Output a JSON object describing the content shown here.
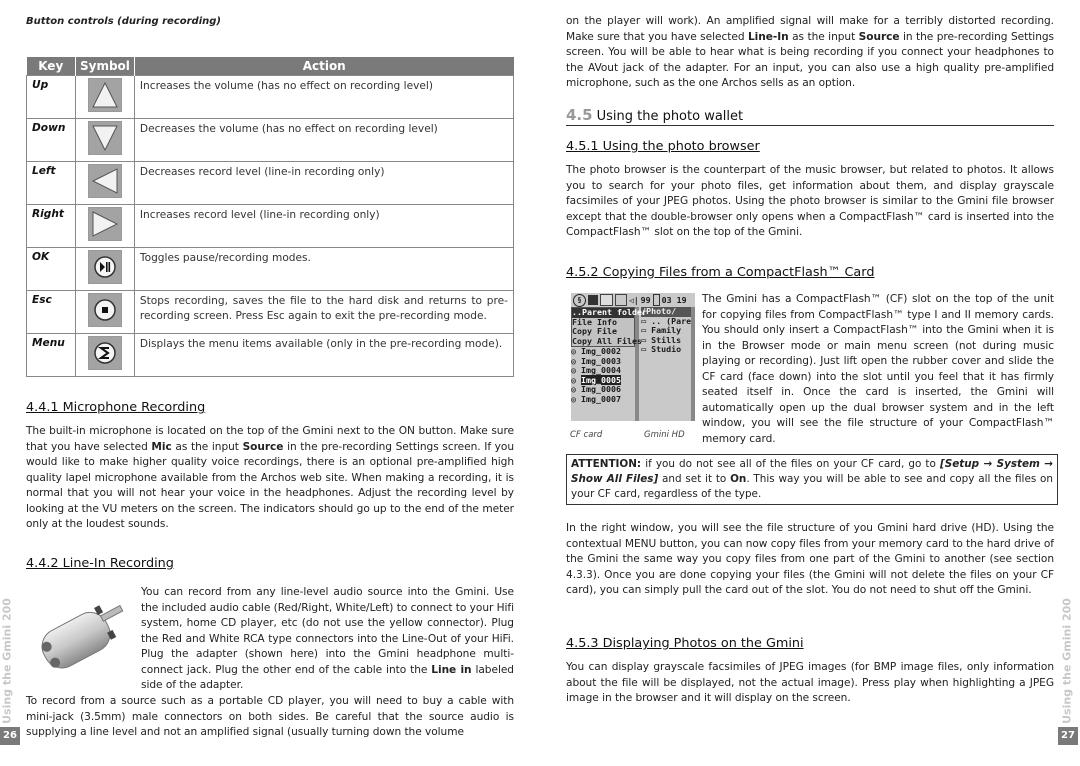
{
  "left_page": {
    "caption": "Button controls (during recording)",
    "table": {
      "headers": [
        "Key",
        "Symbol",
        "Action"
      ],
      "rows": [
        {
          "key": "Up",
          "symbol": "up-arrow-icon",
          "action": "Increases the volume (has no effect on recording level)"
        },
        {
          "key": "Down",
          "symbol": "down-arrow-icon",
          "action": "Decreases the volume (has no effect on recording level)"
        },
        {
          "key": "Left",
          "symbol": "left-arrow-icon",
          "action": "Decreases record level (line-in recording only)"
        },
        {
          "key": "Right",
          "symbol": "right-arrow-icon",
          "action": "Increases record level (line-in recording only)"
        },
        {
          "key": "OK",
          "symbol": "play-pause-icon",
          "action": "Toggles pause/recording modes."
        },
        {
          "key": "Esc",
          "symbol": "stop-icon",
          "action": "Stops recording, saves the file to the hard disk and returns to pre-recording screen. Press Esc again to exit the pre-recording mode."
        },
        {
          "key": "Menu",
          "symbol": "menu-icon",
          "action": "Displays the menu items available (only in the pre-recording mode)."
        }
      ]
    },
    "mic": {
      "heading": "4.4.1 Microphone Recording",
      "p1_a": "The built-in microphone is located on the top of the Gmini next to the ON button. Make sure that you have selected ",
      "p1_b": "Mic",
      "p1_c": " as the input ",
      "p1_d": "Source",
      "p1_e": " in the pre-recording Settings screen. If you would like to make higher quality voice recordings, there is an optional pre-amplified high quality lapel microphone available from the Archos web site. When making a recording, it is normal that you will not hear your voice in the headphones. Adjust the recording level by looking at the VU meters on the screen. The indicators should go up to the end of the meter only at the loudest sounds."
    },
    "linein": {
      "heading": "4.4.2 Line-In Recording",
      "p1_a": "You can record from any line-level audio source into the Gmini. Use the included audio cable (Red/Right, White/Left) to connect to your Hifi system, home CD player, etc (do not use the yellow connector). Plug the Red and White RCA type connectors into the Line-Out of your HiFi. Plug the adapter (shown here) into the Gmini headphone multi-connect jack. Plug the other end of the cable into the ",
      "p1_b": "Line in",
      "p1_c": " labeled side of the adapter.",
      "p2": "To record from a source such as a portable CD player, you will need to buy a cable with mini-jack (3.5mm) male connectors on both sides. Be careful that the source audio is supplying a line level and not an amplified signal (usually turning down the volume"
    },
    "side_tab": "Using the Gmini 200",
    "page_number": "26"
  },
  "right_page": {
    "cont_a": "on the player will work). An amplified signal will make for a terribly distorted recording. Make sure that you have selected ",
    "cont_b": "Line-In",
    "cont_c": " as the input ",
    "cont_d": "Source",
    "cont_e": " in the pre-recording Settings screen. You will be able to hear what is being recording if you connect your headphones to the AVout jack of the adapter. For an input, you can also use a high quality pre-amplified microphone, such as the one Archos sells as an option.",
    "section": {
      "number": "4.5",
      "title": "Using the photo wallet"
    },
    "browser": {
      "heading": "4.5.1 Using the photo browser",
      "p": "The photo browser is the counterpart of the music browser, but related to photos. It allows you to search for your photo files, get information about them, and display grayscale facsimiles of your JPEG photos. Using the photo browser is similar to the Gmini file browser except that the double-browser only opens when a CompactFlash™ card is inserted into the CompactFlash™ slot on the top of the Gmini."
    },
    "copying": {
      "heading": "4.5.2 Copying Files from a CompactFlash™ Card",
      "p1": "The Gmini has a CompactFlash™ (CF) slot on the top of the unit for copying files from CompactFlash™ type I and II memory cards. You should only insert a CompactFlash™ into the Gmini when it is in the Browser mode or main menu screen (not during music playing or recording). Just lift open the rubber cover and slide the CF card (face down) into the slot until you feel that it has firmly seated itself in. Once the card is inserted, the Gmini will automatically open up the dual browser system and in the left window, you will see the file structure of your CompactFlash™ memory card.",
      "screen": {
        "volume": "99",
        "time": "03 19",
        "left_menu": [
          "..Parent folder",
          "File Info",
          "Copy File",
          "Copy All Files"
        ],
        "left_files": [
          "Img_0002",
          "Img_0003",
          "Img_0004",
          "Img_0005",
          "Img_0006",
          "Img_0007"
        ],
        "selected_file": "Img_0005",
        "right_path": "/Photo/",
        "right_items": [
          ".. (Pare",
          "Family",
          "Stills",
          "Studio"
        ],
        "caption_left": "CF card",
        "caption_right": "Gmini HD"
      },
      "attention_a": "ATTENTION:",
      "attention_b": " if you do not see all of the files on your CF card, go to ",
      "attention_c": "[Setup → System → Show All Files]",
      "attention_d": " and set it to ",
      "attention_e": "On",
      "attention_f": ". This way you will be able to see and copy all the files on your CF card, regardless of the type.",
      "p2": "In the right window, you will see the file structure of you Gmini hard drive (HD). Using the contextual MENU button, you can now copy files from your memory card to the hard drive of the Gmini the same way you copy files from one part of the Gmini to another (see section 4.3.3). Once you are done copying your files (the Gmini will not delete the files on your CF card), you can simply pull the card out of the slot. You do not need to shut off the Gmini."
    },
    "displaying": {
      "heading": "4.5.3 Displaying Photos on the Gmini",
      "p": "You can display grayscale facsimiles of JPEG images (for BMP image files, only information about the file will be displayed, not the actual image). Press play when highlighting a JPEG image in the browser and it will display on the screen."
    },
    "side_tab": "Using the Gmini 200",
    "page_number": "27"
  }
}
